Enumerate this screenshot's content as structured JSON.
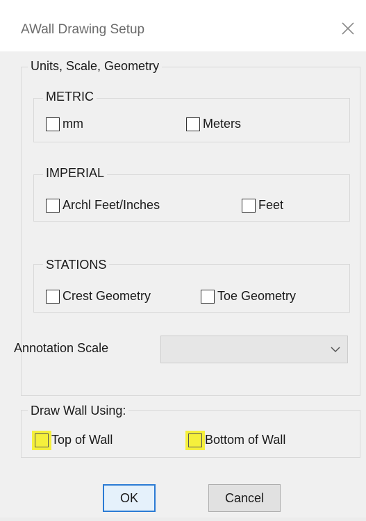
{
  "window": {
    "title": "AWall Drawing Setup",
    "close_glyph": "×"
  },
  "units_group": {
    "label": "Units, Scale, Geometry",
    "metric": {
      "label": "METRIC",
      "options": [
        {
          "label": "mm",
          "checked": false
        },
        {
          "label": "Meters",
          "checked": false
        }
      ]
    },
    "imperial": {
      "label": "IMPERIAL",
      "options": [
        {
          "label": "Archl Feet/Inches",
          "checked": false
        },
        {
          "label": "Feet",
          "checked": false
        }
      ]
    },
    "stations": {
      "label": "STATIONS",
      "options": [
        {
          "label": "Crest Geometry",
          "checked": false
        },
        {
          "label": "Toe Geometry",
          "checked": false
        }
      ]
    },
    "annotation_scale": {
      "label": "Annotation Scale",
      "value": ""
    }
  },
  "draw_wall": {
    "label": "Draw Wall Using:",
    "options": [
      {
        "label": "Top of Wall",
        "checked": false,
        "highlight_color": "#f5f03c"
      },
      {
        "label": "Bottom of Wall",
        "checked": false,
        "highlight_color": "#f5f03c"
      }
    ]
  },
  "buttons": {
    "ok": "OK",
    "cancel": "Cancel"
  },
  "colors": {
    "dialog_bg": "#f0f0f0",
    "title_bg": "#ffffff",
    "default_button_border": "#2b7bd4",
    "highlight": "#f5f03c"
  }
}
